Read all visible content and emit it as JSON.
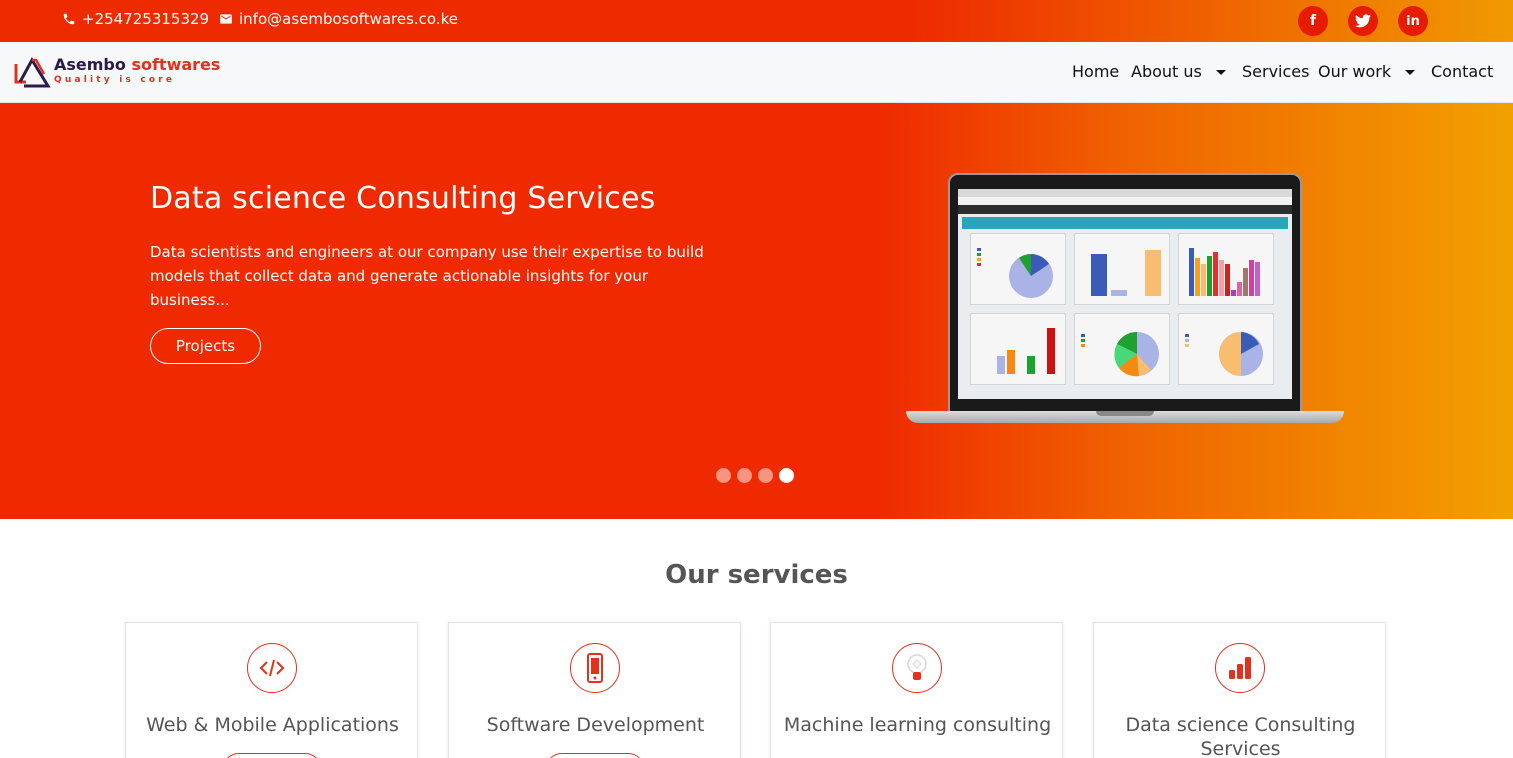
{
  "topbar": {
    "phone": "+254725315329",
    "email": "info@asembosoftwares.co.ke",
    "social": [
      "facebook",
      "twitter",
      "linkedin"
    ]
  },
  "brand": {
    "name_main": "Asembo",
    "name_accent": "softwares",
    "tagline": "Quality is core"
  },
  "nav": {
    "items": [
      "Home",
      "About us",
      "Services",
      "Our work",
      "Contact"
    ]
  },
  "hero": {
    "title": "Data science Consulting Services",
    "description": "Data scientists and engineers at our company use their expertise to build models that collect data and generate actionable insights for your business...",
    "button": "Projects",
    "slides": 4,
    "active_slide": 4
  },
  "services": {
    "title": "Our services",
    "cards": [
      {
        "title": "Web & Mobile Applications",
        "icon": "code-icon"
      },
      {
        "title": "Software Development",
        "icon": "mobile-icon"
      },
      {
        "title": "Machine learning consulting",
        "icon": "lightbulb-icon"
      },
      {
        "title": "Data science Consulting Services",
        "icon": "bar-chart-icon"
      }
    ]
  },
  "colors": {
    "primary": "#ef2a00",
    "gradient_end": "#f2a000",
    "accent": "#e2311d",
    "brand_dark": "#2b1a4a"
  }
}
